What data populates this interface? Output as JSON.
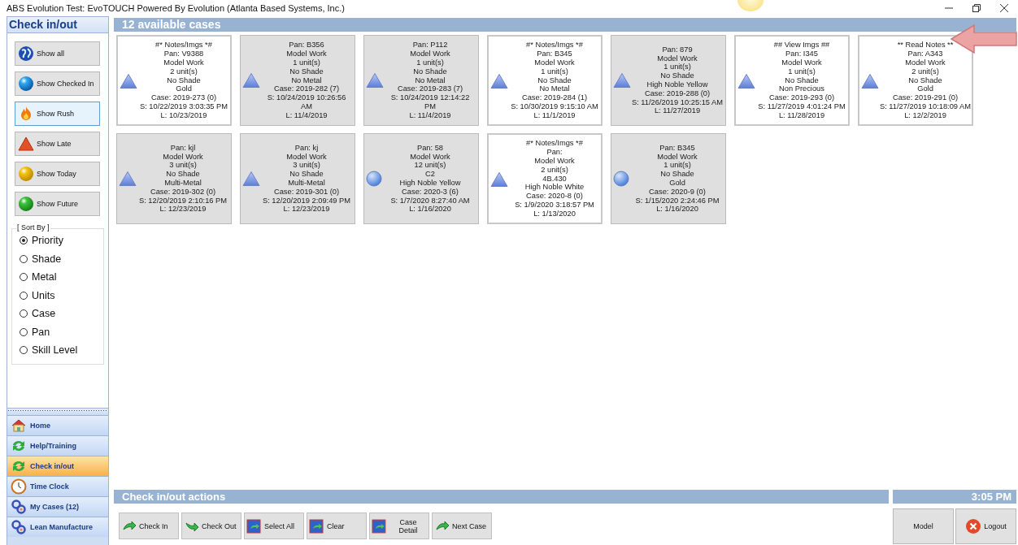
{
  "window": {
    "title": "ABS Evolution Test: EvoTOUCH Powered By Evolution (Atlanta Based Systems, Inc.)"
  },
  "sidebar": {
    "title": "Check in/out",
    "filters": [
      {
        "label": "Show all",
        "selected": false
      },
      {
        "label": "Show Checked In",
        "selected": false
      },
      {
        "label": "Show Rush",
        "selected": true
      },
      {
        "label": "Show Late",
        "selected": false
      },
      {
        "label": "Show Today",
        "selected": false
      },
      {
        "label": "Show Future",
        "selected": false
      }
    ],
    "sort": {
      "title": "[ Sort By ]",
      "options": [
        {
          "label": "Priority",
          "selected": true
        },
        {
          "label": "Shade",
          "selected": false
        },
        {
          "label": "Metal",
          "selected": false
        },
        {
          "label": "Units",
          "selected": false
        },
        {
          "label": "Case",
          "selected": false
        },
        {
          "label": "Pan",
          "selected": false
        },
        {
          "label": "Skill Level",
          "selected": false
        }
      ]
    },
    "nav": [
      {
        "label": "Home",
        "selected": false
      },
      {
        "label": "Help/Training",
        "selected": false
      },
      {
        "label": "Check in/out",
        "selected": true
      },
      {
        "label": "Time Clock",
        "selected": false
      },
      {
        "label": "My Cases (12)",
        "selected": false
      },
      {
        "label": "Lean Manufacture",
        "selected": false
      }
    ]
  },
  "cases": {
    "title": "12 available cases",
    "items": [
      {
        "highlighted": true,
        "kind": "triangle",
        "lines": [
          "#* Notes/Imgs *#",
          "Pan: V9388",
          "Model Work",
          "2 unit(s)",
          "No Shade",
          "Gold",
          "Case: 2019-273 (0)",
          "S: 10/22/2019 3:03:35 PM",
          "L: 10/23/2019"
        ]
      },
      {
        "highlighted": false,
        "kind": "triangle",
        "lines": [
          "Pan: B356",
          "Model Work",
          "1 unit(s)",
          "No Shade",
          "No Metal",
          "Case: 2019-282 (7)",
          "S: 10/24/2019 10:26:56 AM",
          "L: 11/4/2019"
        ]
      },
      {
        "highlighted": false,
        "kind": "triangle",
        "lines": [
          "Pan: P112",
          "Model Work",
          "1 unit(s)",
          "No Shade",
          "No Metal",
          "Case: 2019-283 (7)",
          "S: 10/24/2019 12:14:22 PM",
          "L: 11/4/2019"
        ]
      },
      {
        "highlighted": true,
        "kind": "triangle",
        "lines": [
          "#* Notes/Imgs *#",
          "Pan: B345",
          "Model Work",
          "1 unit(s)",
          "No Shade",
          "No Metal",
          "Case: 2019-284 (1)",
          "S: 10/30/2019 9:15:10 AM",
          "L: 11/1/2019"
        ]
      },
      {
        "highlighted": false,
        "kind": "triangle",
        "lines": [
          "Pan: 879",
          "Model Work",
          "1 unit(s)",
          "No Shade",
          "High Noble Yellow",
          "Case: 2019-288 (0)",
          "S: 11/26/2019 10:25:15 AM",
          "L: 11/27/2019"
        ]
      },
      {
        "highlighted": true,
        "kind": "triangle",
        "lines": [
          "## View Imgs ##",
          "Pan: I345",
          "Model Work",
          "1 unit(s)",
          "No Shade",
          "Non Precious",
          "Case: 2019-293 (0)",
          "S: 11/27/2019 4:01:24 PM",
          "L: 11/28/2019"
        ]
      },
      {
        "highlighted": true,
        "kind": "triangle",
        "lines": [
          "** Read Notes **",
          "Pan: A343",
          "Model Work",
          "2 unit(s)",
          "No Shade",
          "Gold",
          "Case: 2019-291 (0)",
          "S: 11/27/2019 10:18:09 AM",
          "L: 12/2/2019"
        ]
      },
      {
        "highlighted": false,
        "kind": "triangle",
        "lines": [
          "Pan: kjl",
          "Model Work",
          "3 unit(s)",
          "No Shade",
          "Multi-Metal",
          "Case: 2019-302 (0)",
          "S: 12/20/2019 2:10:16 PM",
          "L: 12/23/2019"
        ]
      },
      {
        "highlighted": false,
        "kind": "triangle",
        "lines": [
          "Pan: kj",
          "Model Work",
          "3 unit(s)",
          "No Shade",
          "Multi-Metal",
          "Case: 2019-301 (0)",
          "S: 12/20/2019 2:09:49 PM",
          "L: 12/23/2019"
        ]
      },
      {
        "highlighted": false,
        "kind": "circle",
        "lines": [
          "Pan: 58",
          "Model Work",
          "12 unit(s)",
          "C2",
          "High Noble Yellow",
          "Case: 2020-3 (6)",
          "S: 1/7/2020 8:27:40 AM",
          "L: 1/16/2020"
        ]
      },
      {
        "highlighted": true,
        "kind": "triangle",
        "lines": [
          "#* Notes/Imgs *#",
          "Pan:",
          "Model Work",
          "2 unit(s)",
          "4B.430",
          "High Noble White",
          "Case: 2020-8 (0)",
          "S: 1/9/2020 3:18:57 PM",
          "L: 1/13/2020"
        ]
      },
      {
        "highlighted": false,
        "kind": "circle",
        "lines": [
          "Pan: B345",
          "Model Work",
          "1 unit(s)",
          "No Shade",
          "Gold",
          "Case: 2020-9 (0)",
          "S: 1/15/2020 2:24:46 PM",
          "L: 1/16/2020"
        ]
      }
    ]
  },
  "actions": {
    "title": "Check in/out actions",
    "buttons": [
      "Check In",
      "Check Out",
      "Select All",
      "Clear",
      "Case Detail",
      "Next Case"
    ]
  },
  "clock": {
    "time": "3:05 PM"
  },
  "session_buttons": [
    "Model",
    "Logout"
  ]
}
